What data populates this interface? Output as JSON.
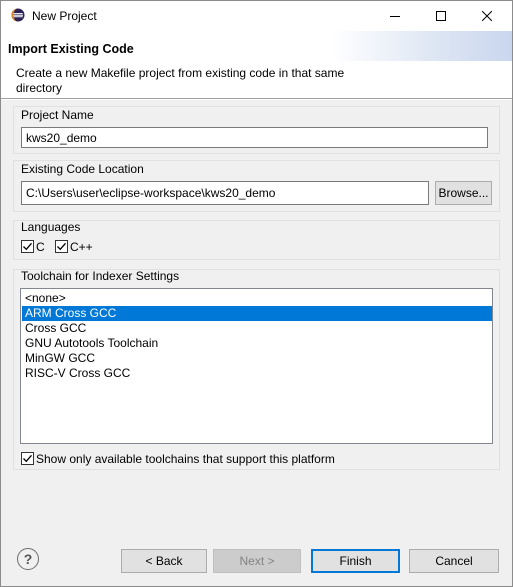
{
  "window": {
    "title": "New Project",
    "app_icon": "eclipse-icon"
  },
  "banner": {
    "title": "Import Existing Code",
    "description": "Create a new Makefile project from existing code in that same directory"
  },
  "project_name": {
    "label": "Project Name",
    "value": "kws20_demo"
  },
  "code_location": {
    "label": "Existing Code Location",
    "value": "C:\\Users\\user\\eclipse-workspace\\kws20_demo",
    "browse_label": "Browse..."
  },
  "languages": {
    "label": "Languages",
    "options": [
      {
        "label": "C",
        "checked": true
      },
      {
        "label": "C++",
        "checked": true
      }
    ]
  },
  "toolchain": {
    "label": "Toolchain for Indexer Settings",
    "items": [
      "<none>",
      "ARM Cross GCC",
      "Cross GCC",
      "GNU Autotools Toolchain",
      "MinGW GCC",
      "RISC-V Cross GCC"
    ],
    "selected": "ARM Cross GCC",
    "show_only_label": "Show only available toolchains that support this platform",
    "show_only_checked": true
  },
  "footer": {
    "back_label": "< Back",
    "next_label": "Next >",
    "finish_label": "Finish",
    "cancel_label": "Cancel"
  },
  "colors": {
    "selection": "#0078d7",
    "default_button_border": "#0078d7"
  }
}
